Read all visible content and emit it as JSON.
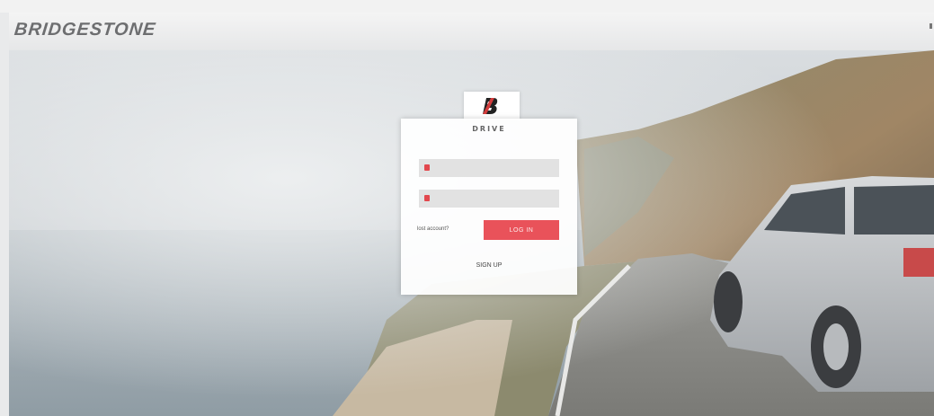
{
  "header": {
    "logo_text": "BRIDGESTONE",
    "brand_color": "#c73b3a"
  },
  "login": {
    "app_name": "DRIVE",
    "username_placeholder": "",
    "password_placeholder": "",
    "lost_account_label": "lost account?",
    "login_button_label": "LOG IN",
    "signup_label": "SIGN UP",
    "accent_color": "#e9525a"
  },
  "icons": {
    "app_logo": "bridgestone-b-icon",
    "username": "user-icon",
    "password": "lock-icon"
  }
}
